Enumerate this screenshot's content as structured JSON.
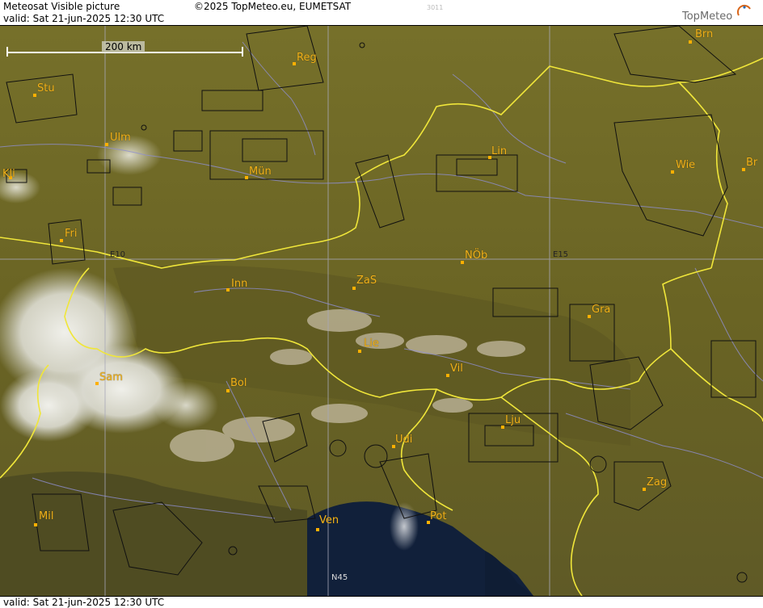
{
  "header": {
    "title": "Meteosat Visible picture",
    "valid": "valid:  Sat  21-jun-2025  12:30 UTC",
    "copyright": "©2025 TopMeteo.eu, EUMETSAT",
    "code": "3011",
    "logo": "TopMeteo"
  },
  "footer": {
    "valid": "valid:  Sat  21-jun-2025  12:30 UTC"
  },
  "scale": {
    "label": "200 km"
  },
  "grid_labels": {
    "e10": "E10",
    "e15": "E15",
    "n45": "N45"
  },
  "cities": [
    {
      "id": "brn",
      "label": "Brn"
    },
    {
      "id": "reg",
      "label": "Reg"
    },
    {
      "id": "stu",
      "label": "Stu"
    },
    {
      "id": "ulm",
      "label": "Ulm"
    },
    {
      "id": "mun",
      "label": "Mün"
    },
    {
      "id": "lin",
      "label": "Lin"
    },
    {
      "id": "wie",
      "label": "Wie"
    },
    {
      "id": "br",
      "label": "Br"
    },
    {
      "id": "kli",
      "label": "Kli"
    },
    {
      "id": "fri",
      "label": "Fri"
    },
    {
      "id": "inn",
      "label": "Inn"
    },
    {
      "id": "zas",
      "label": "ZaS"
    },
    {
      "id": "nob",
      "label": "NÖb"
    },
    {
      "id": "gra",
      "label": "Gra"
    },
    {
      "id": "lie",
      "label": "Lie"
    },
    {
      "id": "vil",
      "label": "Vil"
    },
    {
      "id": "sam",
      "label": "Sam"
    },
    {
      "id": "bol",
      "label": "Bol"
    },
    {
      "id": "lju",
      "label": "Lju"
    },
    {
      "id": "udi",
      "label": "Udi"
    },
    {
      "id": "zag",
      "label": "Zag"
    },
    {
      "id": "mil",
      "label": "Mil"
    },
    {
      "id": "ven",
      "label": "Ven"
    },
    {
      "id": "pot",
      "label": "Pot"
    }
  ]
}
